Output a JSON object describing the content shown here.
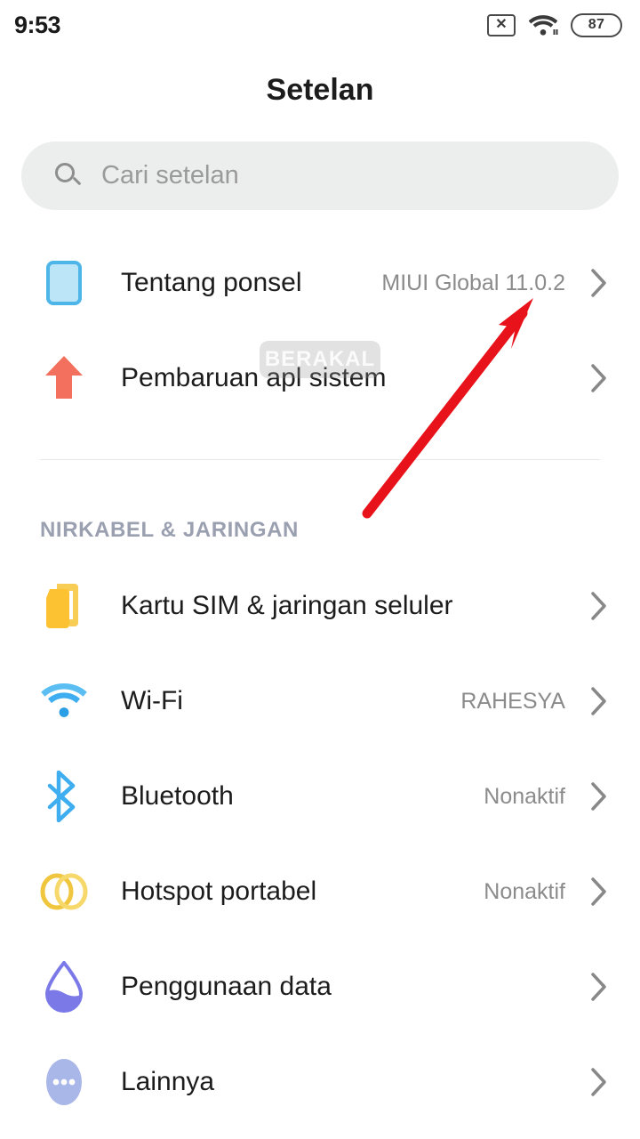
{
  "status_bar": {
    "clock": "9:53",
    "sim_icon": "sim-card-no-signal-icon",
    "sim_glyph": "✕",
    "wifi_icon": "wifi-icon",
    "battery_level": "87"
  },
  "header": {
    "title": "Setelan"
  },
  "search": {
    "icon": "search-icon",
    "placeholder": "Cari setelan",
    "value": ""
  },
  "top_rows": [
    {
      "label": "Tentang ponsel",
      "value": "MIUI Global 11.0.2",
      "icon": "phone-outline-icon",
      "icon_color": "#a9dcf5"
    },
    {
      "label": "Pembaruan apl sistem",
      "value": "",
      "icon": "up-arrow-icon",
      "icon_color": "#f4705e"
    }
  ],
  "sections": [
    {
      "title": "NIRKABEL & JARINGAN",
      "items": [
        {
          "label": "Kartu SIM & jaringan seluler",
          "value": "",
          "icon": "sim-cards-icon",
          "icon_color": "#fcc232"
        },
        {
          "label": "Wi-Fi",
          "value": "RAHESYA",
          "icon": "wifi-icon",
          "icon_color": "#3faef0"
        },
        {
          "label": "Bluetooth",
          "value": "Nonaktif",
          "icon": "bluetooth-icon",
          "icon_color": "#3faef0"
        },
        {
          "label": "Hotspot portabel",
          "value": "Nonaktif",
          "icon": "hotspot-rings-icon",
          "icon_color": "#f3cc4c"
        },
        {
          "label": "Penggunaan data",
          "value": "",
          "icon": "water-drop-icon",
          "icon_color": "#7b79e8"
        },
        {
          "label": "Lainnya",
          "value": "",
          "icon": "more-dots-icon",
          "icon_color": "#a9b6e8"
        }
      ]
    }
  ],
  "watermark": {
    "text": "BERAKAL"
  },
  "annotation": {
    "type": "arrow",
    "color": "#e8131a",
    "points_to": "MIUI Global 11.0.2"
  },
  "colors": {
    "accent_blue": "#3faef0",
    "annotation_red": "#e8131a",
    "section_header": "#9aa0b0",
    "value_text": "#8b8b8b"
  }
}
